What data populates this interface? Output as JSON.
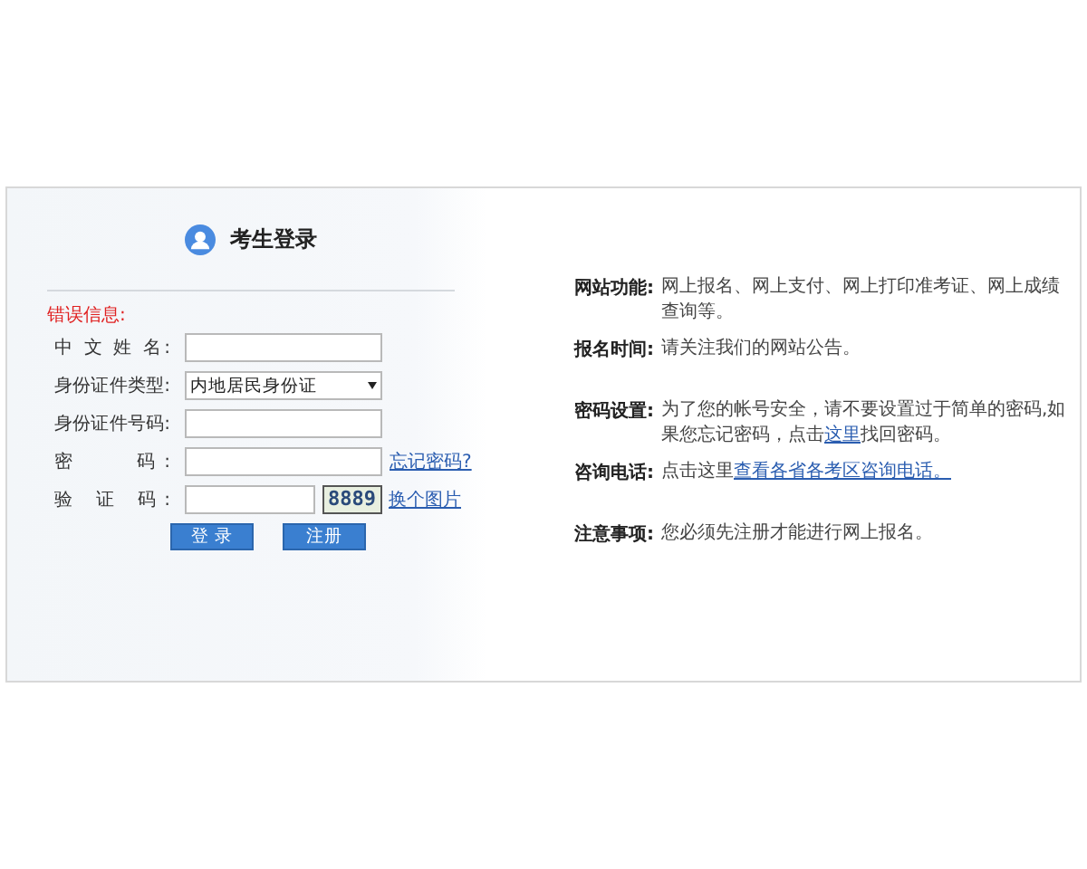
{
  "login": {
    "title": "考生登录",
    "error_label": "错误信息:",
    "fields": [
      {
        "kind": "text",
        "label": "中 文 姓 名:"
      },
      {
        "kind": "select",
        "label": "身份证件类型:",
        "value": "内地居民身份证"
      },
      {
        "kind": "text",
        "label": "身份证件号码:"
      },
      {
        "kind": "password",
        "label": "密　　码:",
        "link": "忘记密码?"
      },
      {
        "kind": "captcha",
        "label": "验 证 码:",
        "captcha": "8889",
        "link": "换个图片"
      }
    ],
    "buttons": [
      "登 录",
      "注册"
    ]
  },
  "info": [
    {
      "label": "网站功能:",
      "parts": [
        {
          "text": "网上报名、网上支付、网上打印准考证、网上成绩查询等。",
          "link": false
        }
      ]
    },
    {
      "label": "报名时间:",
      "parts": [
        {
          "text": "请关注我们的网站公告。",
          "link": false
        }
      ]
    },
    {
      "label": "密码设置:",
      "parts": [
        {
          "text": "为了您的帐号安全，请不要设置过于简单的密码,如果您忘记密码，点击",
          "link": false
        },
        {
          "text": "这里",
          "link": true
        },
        {
          "text": "找回密码。",
          "link": false
        }
      ]
    },
    {
      "label": "咨询电话:",
      "parts": [
        {
          "text": "点击这里",
          "link": false
        },
        {
          "text": "查看各省各考区咨询电话。",
          "link": true
        }
      ]
    },
    {
      "label": "注意事项:",
      "parts": [
        {
          "text": "您必须先注册才能进行网上报名。",
          "link": false
        }
      ]
    }
  ]
}
